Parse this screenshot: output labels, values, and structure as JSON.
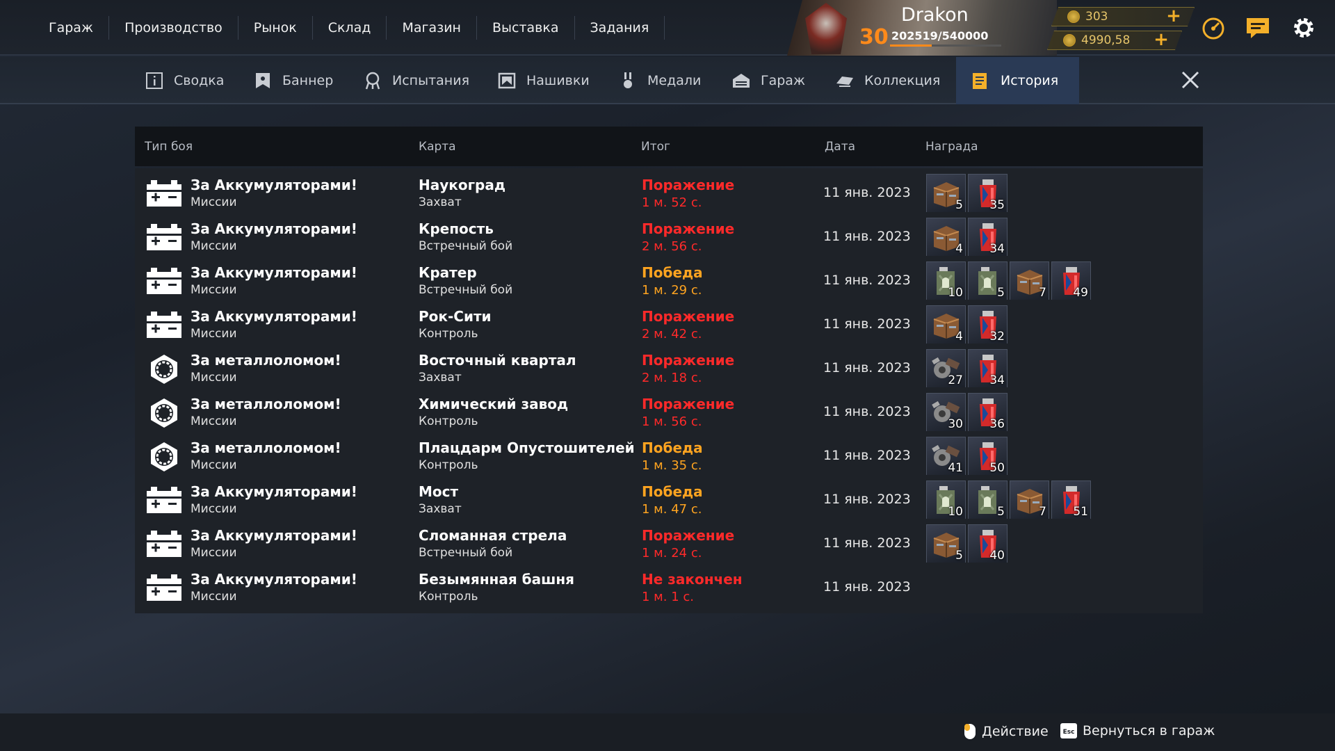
{
  "topnav": [
    "Гараж",
    "Производство",
    "Рынок",
    "Склад",
    "Магазин",
    "Выставка",
    "Задания"
  ],
  "player": {
    "name": "Drakon",
    "level": "30",
    "xp": "202519/540000",
    "xp_progress": 0.375
  },
  "currency": {
    "gold": "303",
    "coins": "4990,58",
    "accent": "#e6c56a"
  },
  "tabs": [
    {
      "label": "Сводка",
      "icon": "info-icon"
    },
    {
      "label": "Баннер",
      "icon": "banner-icon"
    },
    {
      "label": "Испытания",
      "icon": "challenge-icon"
    },
    {
      "label": "Нашивки",
      "icon": "patch-icon"
    },
    {
      "label": "Медали",
      "icon": "medal-icon"
    },
    {
      "label": "Гараж",
      "icon": "garage-icon"
    },
    {
      "label": "Коллекция",
      "icon": "collection-icon"
    },
    {
      "label": "История",
      "icon": "history-icon",
      "active": true
    }
  ],
  "table": {
    "headers": {
      "type": "Тип боя",
      "map": "Карта",
      "result": "Итог",
      "date": "Дата",
      "reward": "Награда"
    },
    "colors": {
      "defeat": "#ff2a2a",
      "victory": "#ffa420",
      "unfinished": "#ff2a2a"
    },
    "rows": [
      {
        "mode_icon": "battery-icon",
        "mode": "За Аккумуляторами!",
        "sub": "Миссии",
        "map": "Наукоград",
        "map_mode": "Захват",
        "result": "Поражение",
        "result_kind": "defeat",
        "duration": "1 м. 52 с.",
        "date": "11 янв. 2023",
        "rewards": [
          {
            "icon": "crate-icon",
            "count": "5"
          },
          {
            "icon": "fuel-icon",
            "count": "35"
          }
        ]
      },
      {
        "mode_icon": "battery-icon",
        "mode": "За Аккумуляторами!",
        "sub": "Миссии",
        "map": "Крепость",
        "map_mode": "Встречный бой",
        "result": "Поражение",
        "result_kind": "defeat",
        "duration": "2 м. 56 с.",
        "date": "11 янв. 2023",
        "rewards": [
          {
            "icon": "crate-icon",
            "count": "4"
          },
          {
            "icon": "fuel-icon",
            "count": "34"
          }
        ]
      },
      {
        "mode_icon": "battery-icon",
        "mode": "За Аккумуляторами!",
        "sub": "Миссии",
        "map": "Кратер",
        "map_mode": "Встречный бой",
        "result": "Победа",
        "result_kind": "victory",
        "duration": "1 м. 29 с.",
        "date": "11 янв. 2023",
        "rewards": [
          {
            "icon": "jerrycan-icon",
            "count": "10"
          },
          {
            "icon": "jerrycan-icon",
            "count": "5"
          },
          {
            "icon": "crate-icon",
            "count": "7"
          },
          {
            "icon": "fuel-icon",
            "count": "49"
          }
        ]
      },
      {
        "mode_icon": "battery-icon",
        "mode": "За Аккумуляторами!",
        "sub": "Миссии",
        "map": "Рок-Сити",
        "map_mode": "Контроль",
        "result": "Поражение",
        "result_kind": "defeat",
        "duration": "2 м. 42 с.",
        "date": "11 янв. 2023",
        "rewards": [
          {
            "icon": "crate-icon",
            "count": "4"
          },
          {
            "icon": "fuel-icon",
            "count": "32"
          }
        ]
      },
      {
        "mode_icon": "scrap-icon",
        "mode": "За металлоломом!",
        "sub": "Миссии",
        "map": "Восточный квартал",
        "map_mode": "Захват",
        "result": "Поражение",
        "result_kind": "defeat",
        "duration": "2 м. 18 с.",
        "date": "11 янв. 2023",
        "rewards": [
          {
            "icon": "scrap-metal-icon",
            "count": "27"
          },
          {
            "icon": "fuel-icon",
            "count": "34"
          }
        ]
      },
      {
        "mode_icon": "scrap-icon",
        "mode": "За металлоломом!",
        "sub": "Миссии",
        "map": "Химический завод",
        "map_mode": "Контроль",
        "result": "Поражение",
        "result_kind": "defeat",
        "duration": "1 м. 56 с.",
        "date": "11 янв. 2023",
        "rewards": [
          {
            "icon": "scrap-metal-icon",
            "count": "30"
          },
          {
            "icon": "fuel-icon",
            "count": "36"
          }
        ]
      },
      {
        "mode_icon": "scrap-icon",
        "mode": "За металлоломом!",
        "sub": "Миссии",
        "map": "Плацдарм Опустошителей",
        "map_mode": "Контроль",
        "result": "Победа",
        "result_kind": "victory",
        "duration": "1 м. 35 с.",
        "date": "11 янв. 2023",
        "rewards": [
          {
            "icon": "scrap-metal-icon",
            "count": "41"
          },
          {
            "icon": "fuel-icon",
            "count": "50"
          }
        ]
      },
      {
        "mode_icon": "battery-icon",
        "mode": "За Аккумуляторами!",
        "sub": "Миссии",
        "map": "Мост",
        "map_mode": "Захват",
        "result": "Победа",
        "result_kind": "victory",
        "duration": "1 м. 47 с.",
        "date": "11 янв. 2023",
        "rewards": [
          {
            "icon": "jerrycan-icon",
            "count": "10"
          },
          {
            "icon": "jerrycan-icon",
            "count": "5"
          },
          {
            "icon": "crate-icon",
            "count": "7"
          },
          {
            "icon": "fuel-icon",
            "count": "51"
          }
        ]
      },
      {
        "mode_icon": "battery-icon",
        "mode": "За Аккумуляторами!",
        "sub": "Миссии",
        "map": "Сломанная стрела",
        "map_mode": "Встречный бой",
        "result": "Поражение",
        "result_kind": "defeat",
        "duration": "1 м. 24 с.",
        "date": "11 янв. 2023",
        "rewards": [
          {
            "icon": "crate-icon",
            "count": "5"
          },
          {
            "icon": "fuel-icon",
            "count": "40"
          }
        ]
      },
      {
        "mode_icon": "battery-icon",
        "mode": "За Аккумуляторами!",
        "sub": "Миссии",
        "map": "Безымянная башня",
        "map_mode": "Контроль",
        "result": "Не закончен",
        "result_kind": "unfinished",
        "duration": "1 м. 1 с.",
        "date": "11 янв. 2023",
        "rewards": []
      }
    ]
  },
  "footer": {
    "action_label": "Действие",
    "back_label": "Вернуться в гараж",
    "back_key": "Esc"
  }
}
